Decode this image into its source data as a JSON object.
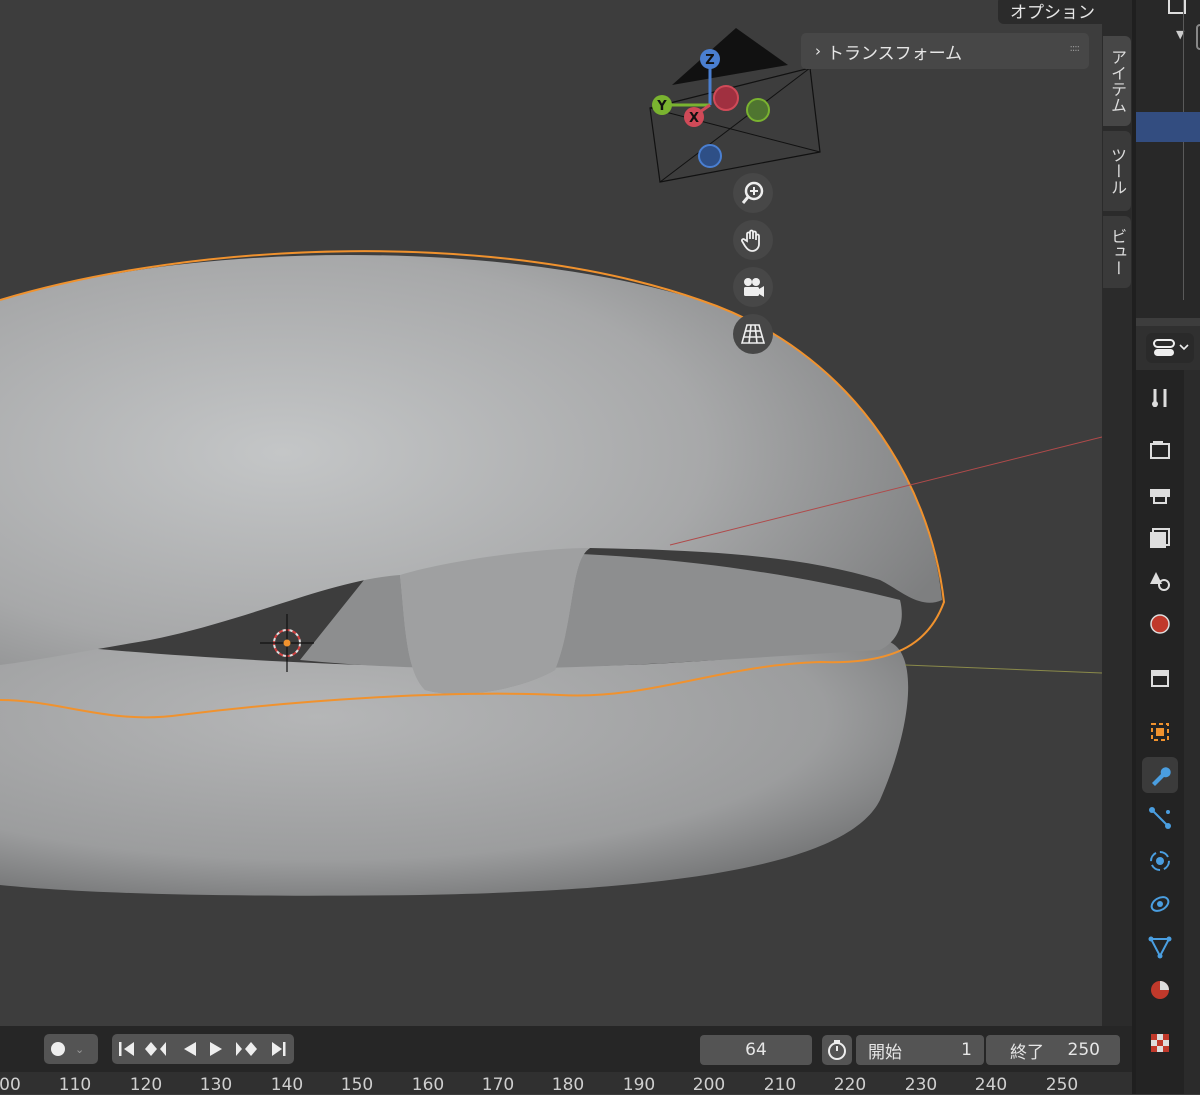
{
  "header": {
    "options_label": "オプション",
    "options_chevron": "⌄"
  },
  "n_panel": {
    "transform_label": "トランスフォーム",
    "grip": "::::",
    "tabs": [
      "アイテム",
      "ツール",
      "ビュー"
    ]
  },
  "navigation": {
    "gizmo_axes": [
      "Z",
      "Y",
      "X"
    ],
    "buttons": [
      "zoom-icon",
      "hand-pan-icon",
      "camera-icon",
      "grid-perspective-icon"
    ]
  },
  "timeline": {
    "current_frame": "64",
    "start_label": "開始",
    "start_value": "1",
    "end_label": "終了",
    "end_value": "250",
    "ruler_ticks": [
      "00",
      "110",
      "120",
      "130",
      "140",
      "150",
      "160",
      "170",
      "180",
      "190",
      "200",
      "210",
      "220",
      "230",
      "240",
      "250"
    ]
  },
  "properties_tabs": [
    "tool-icon",
    "render-icon",
    "output-icon",
    "view-layer-icon",
    "scene-icon",
    "world-icon",
    "collection-icon",
    "object-icon",
    "modifier-icon",
    "particles-icon",
    "physics-icon",
    "constraints-icon",
    "data-icon",
    "material-icon",
    "texture-icon"
  ],
  "colors": {
    "selection_outline": "#f0922e",
    "accent_blue": "#4a7fd1",
    "viewport_bg": "#3d3d3d"
  }
}
